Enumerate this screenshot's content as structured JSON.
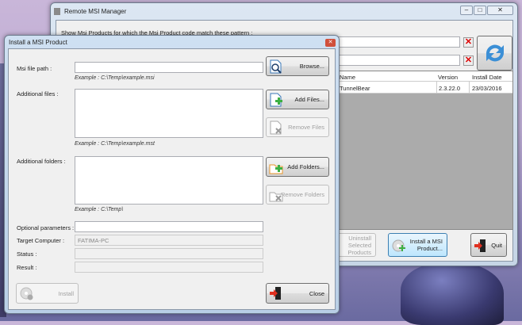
{
  "main": {
    "title": "Remote MSI Manager",
    "pattern_label": "Show Msi Products for which the Msi Product code match these pattern :",
    "grid": {
      "columns": [
        "Name",
        "Version",
        "Install Date"
      ],
      "rows": [
        {
          "name": "TunnelBear",
          "version": "2.3.22.0",
          "date": "23/03/2016"
        }
      ]
    },
    "buttons": {
      "uninstall": "Uninstall Selected Products",
      "install_msi": "Install a MSI Product...",
      "quit": "Quit"
    }
  },
  "dialog": {
    "title": "Install a MSI Product",
    "msi_path_label": "Msi file path :",
    "msi_path_value": "",
    "browse": "Browse...",
    "msi_example": "Example : C:\\Temp\\example.msi",
    "files_label": "Additional files :",
    "add_files": "Add Files...",
    "remove_files": "Remove Files",
    "files_example": "Example : C:\\Temp\\example.mst",
    "folders_label": "Additional folders :",
    "add_folders": "Add Folders...",
    "remove_folders": "Remove Folders",
    "folders_example": "Example : C:\\Temp\\",
    "params_label": "Optional parameters :",
    "params_value": "",
    "target_label": "Target Computer :",
    "target_value": "FATIMA-PC",
    "status_label": "Status :",
    "status_value": "",
    "result_label": "Result :",
    "result_value": "",
    "install": "Install",
    "close": "Close"
  }
}
